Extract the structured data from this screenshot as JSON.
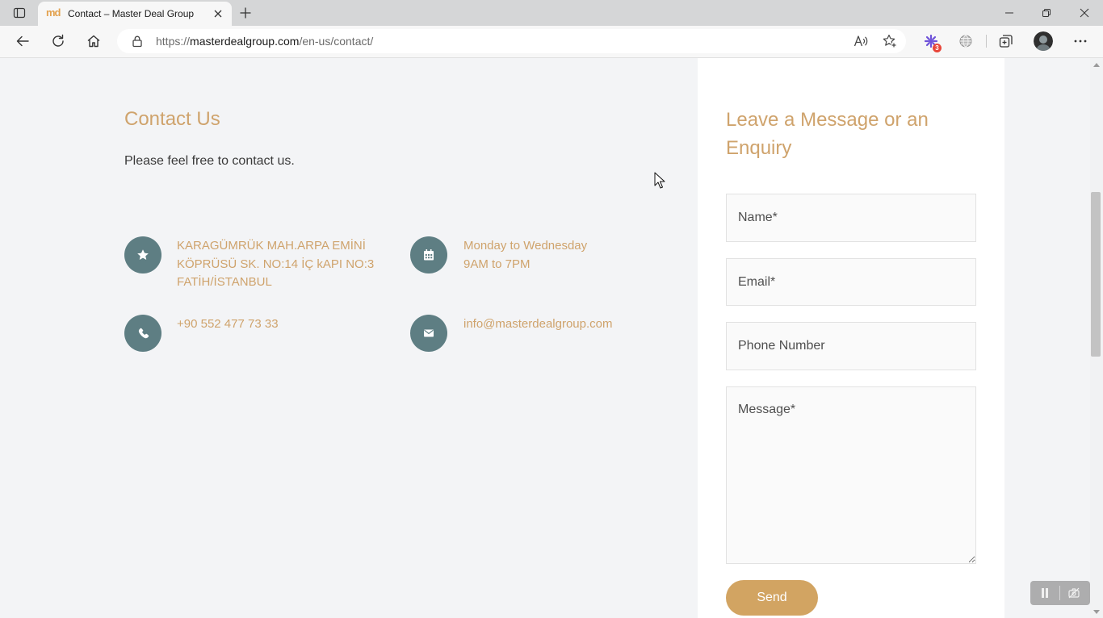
{
  "browser": {
    "tab": {
      "favicon": "md",
      "title": "Contact – Master Deal Group"
    },
    "address": {
      "scheme": "https://",
      "host": "masterdealgroup.com",
      "path": "/en-us/contact/"
    },
    "extension_badge": "3",
    "icons": {
      "tab_actions": "tab-actions-icon",
      "new_tab": "plus-icon",
      "window": [
        "minimize-icon",
        "restore-icon",
        "close-icon"
      ],
      "navigation": [
        "back-arrow-icon",
        "refresh-icon",
        "home-icon"
      ],
      "address_bar": [
        "lock-icon",
        "read-aloud-icon",
        "favorites-add-icon"
      ],
      "toolbar": [
        "extension-icon",
        "globe-icon",
        "collections-icon",
        "profile-avatar",
        "more-icon"
      ]
    }
  },
  "contact": {
    "title": "Contact Us",
    "intro": "Please feel free to contact us.",
    "items": [
      {
        "icon": "star-icon",
        "lines": [
          "KARAGÜMRÜK MAH.ARPA EMİNİ",
          "KÖPRÜSÜ SK. NO:14 İÇ kAPI NO:3",
          "FATİH/İSTANBUL"
        ]
      },
      {
        "icon": "calendar-icon",
        "lines": [
          "Monday to Wednesday",
          "9AM to 7PM"
        ]
      },
      {
        "icon": "phone-icon",
        "lines": [
          "+90 552 477 73 33"
        ]
      },
      {
        "icon": "envelope-icon",
        "lines": [
          "info@masterdealgroup.com"
        ]
      }
    ]
  },
  "form": {
    "title": "Leave a Message or an Enquiry",
    "fields": {
      "name": {
        "placeholder": "Name*"
      },
      "email": {
        "placeholder": "Email*"
      },
      "phone": {
        "placeholder": "Phone Number"
      },
      "message": {
        "placeholder": "Message*"
      }
    },
    "send_label": "Send"
  },
  "colors": {
    "accent": "#cfa36c",
    "button": "#d2a462",
    "icon_circle": "#5e7e83",
    "page_bg": "#f3f4f6",
    "panel_bg": "#ffffff",
    "favicon": "#e3a24f",
    "extension_badge": "#e8463a",
    "extension": "#6f53d9"
  }
}
